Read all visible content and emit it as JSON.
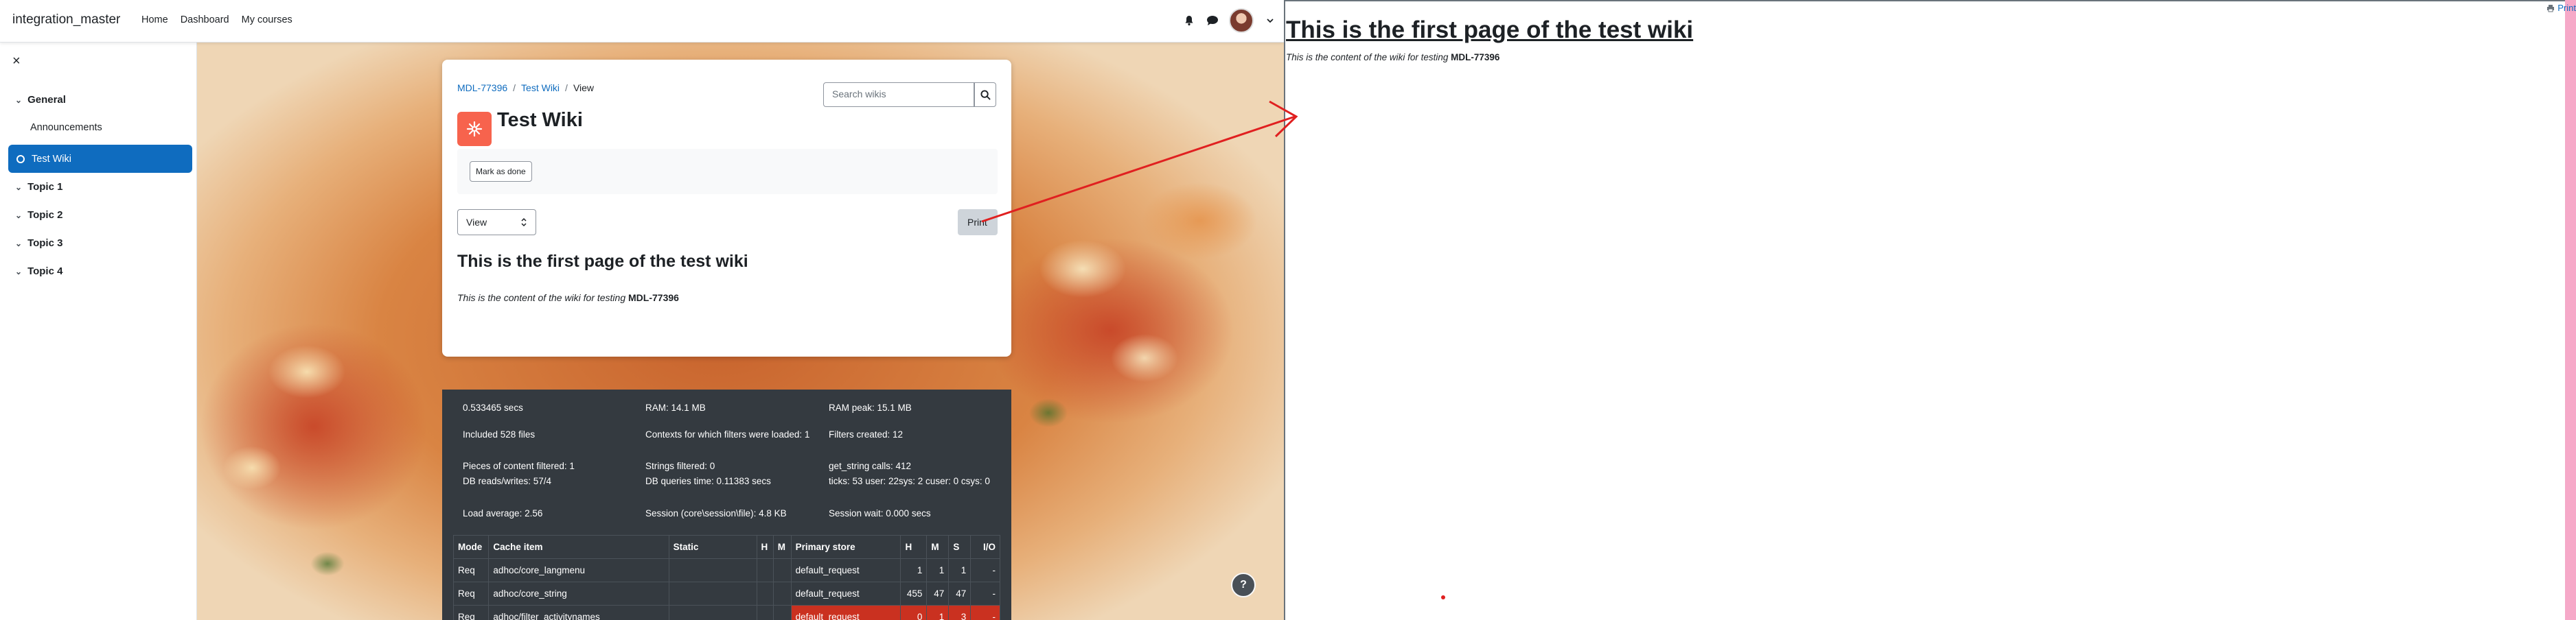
{
  "navbar": {
    "brand": "integration_master",
    "links": [
      "Home",
      "Dashboard",
      "My courses"
    ],
    "icons": [
      "bell-icon",
      "chat-icon",
      "avatar",
      "chevron-down-icon"
    ]
  },
  "drawer": {
    "close_icon": "×",
    "general_label": "General",
    "announcements_label": "Announcements",
    "active_label": "Test Wiki",
    "topics": [
      "Topic 1",
      "Topic 2",
      "Topic 3",
      "Topic 4"
    ]
  },
  "card": {
    "breadcrumb": {
      "course": "MDL-77396",
      "sep": "/",
      "wiki": "Test Wiki",
      "current": "View"
    },
    "search_placeholder": "Search wikis",
    "title": "Test Wiki",
    "mark_done": "Mark as done",
    "view_select": "View",
    "print_button": "Print",
    "wiki_heading": "This is the first page of the test wiki",
    "wiki_content_prefix": "This is the content of the wiki for testing",
    "wiki_content_bold": "MDL-77396"
  },
  "perf": {
    "time": "0.533465 secs",
    "ram": "RAM: 14.1 MB",
    "ram_peak": "RAM peak: 15.1 MB",
    "included_files": "Included 528 files",
    "contexts_filters": "Contexts for which filters were loaded: 1",
    "filters_created": "Filters created: 12",
    "pieces_filtered": "Pieces of content filtered: 1",
    "strings_filtered": "Strings filtered: 0",
    "get_string": "get_string calls: 412",
    "db_reads": "DB reads/writes: 57/4",
    "db_queries": "DB queries time: 0.11383 secs",
    "ticks": "ticks: 53 user: 22sys: 2 cuser: 0 csys: 0",
    "load_avg": "Load average: 2.56",
    "session": "Session (core\\session\\file): 4.8 KB",
    "session_wait": "Session wait: 0.000 secs",
    "table": {
      "headers": [
        "Mode",
        "Cache item",
        "Static",
        "H",
        "M",
        "Primary store",
        "H",
        "M",
        "S",
        "I/O"
      ],
      "rows": [
        [
          "Req",
          "adhoc/core_langmenu",
          "",
          "",
          "",
          "default_request",
          "1",
          "1",
          "1",
          "-"
        ],
        [
          "Req",
          "adhoc/core_string",
          "",
          "",
          "",
          "default_request",
          "455",
          "47",
          "47",
          "-"
        ],
        [
          "Req",
          "adhoc/filter_activitynames",
          "",
          "",
          "",
          "default_request",
          "0",
          "1",
          "3",
          "-"
        ]
      ]
    }
  },
  "help_button": "?",
  "print_preview": {
    "print_link": "Print",
    "heading": "This is the first page of the test wiki",
    "content_prefix": "This is the content of the wiki for testing",
    "content_bold": "MDL-77396"
  },
  "colors": {
    "accent": "#0f6cbf",
    "wiki_icon": "#f7634d",
    "perf_bg": "#343a40",
    "danger": "#ca3120",
    "arrow": "#e02020",
    "pink_strip": "#f6a9c8"
  }
}
